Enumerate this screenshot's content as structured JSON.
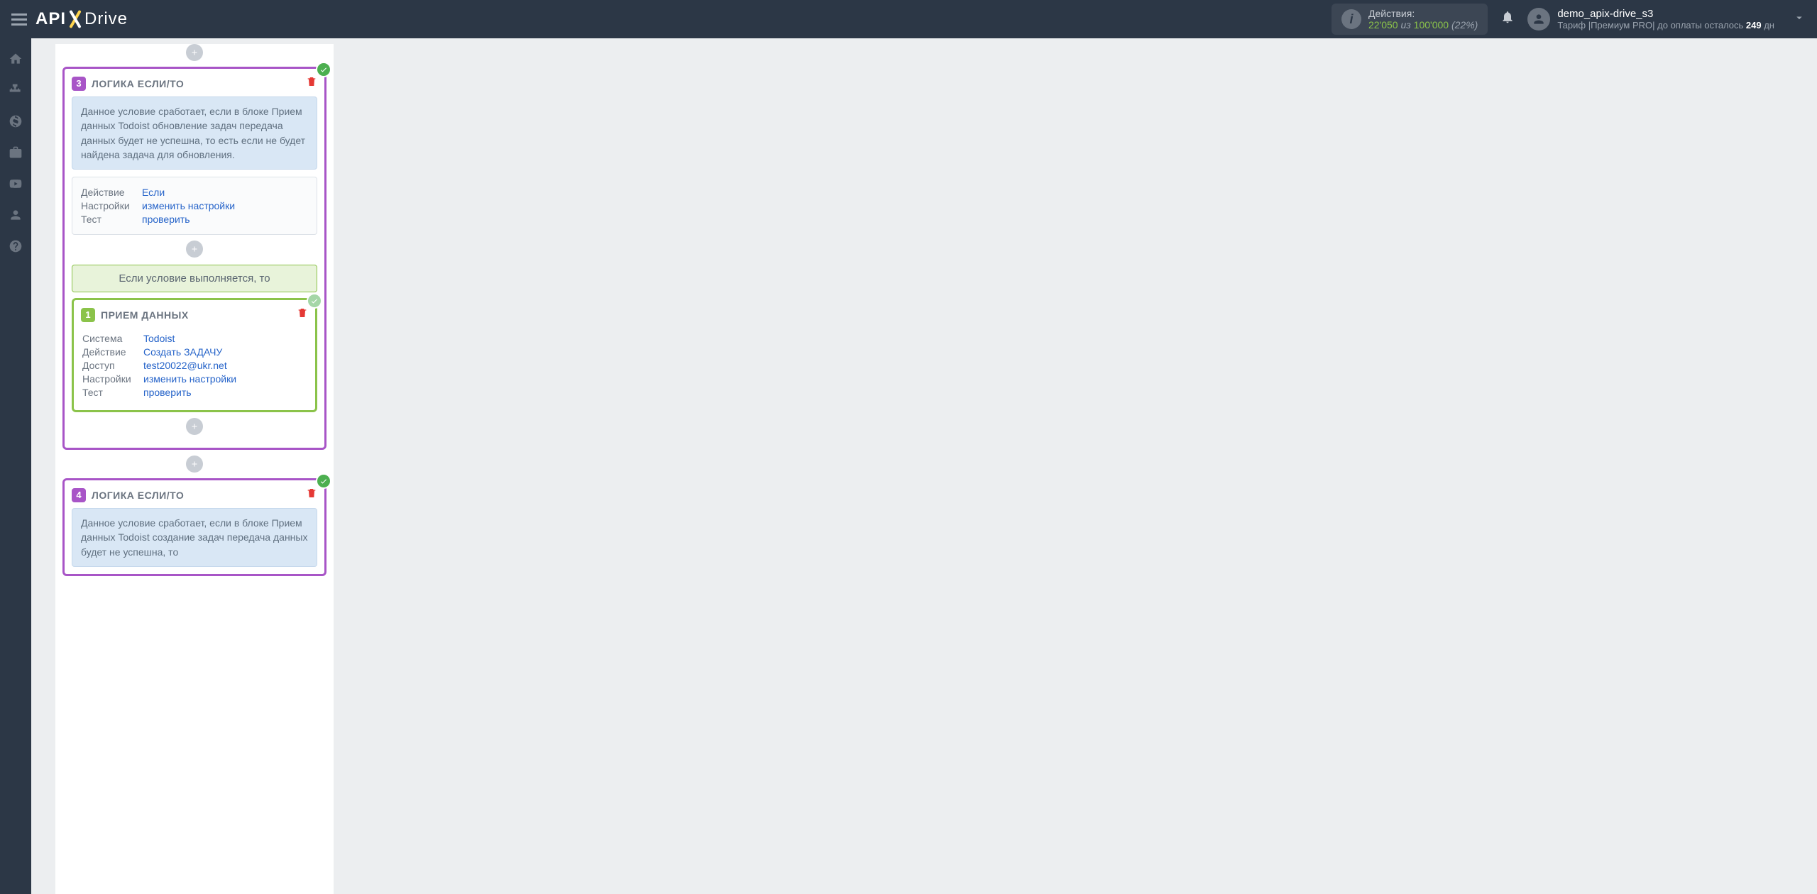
{
  "topbar": {
    "actions_label": "Действия:",
    "used": "22'050",
    "of": "из",
    "total": "100'000",
    "pct": "(22%)"
  },
  "user": {
    "name": "demo_apix-drive_s3",
    "tariff_prefix": "Тариф |Премиум PRO| до оплаты осталось ",
    "days": "249",
    "days_suffix": " дн"
  },
  "card3": {
    "num": "3",
    "title": "ЛОГИКА ЕСЛИ/ТО",
    "desc": "Данное условие сработает, если в блоке Прием данных Todoist обновление задач передача данных будет не успешна, то есть если не будет найдена задача для обновления.",
    "f1_label": "Действие",
    "f1_val": "Если",
    "f2_label": "Настройки",
    "f2_val": "изменить настройки",
    "f3_label": "Тест",
    "f3_val": "проверить",
    "cond": "Если условие выполняется, то"
  },
  "nested1": {
    "num": "1",
    "title": "ПРИЕМ ДАННЫХ",
    "f1_label": "Система",
    "f1_val": "Todoist",
    "f2_label": "Действие",
    "f2_val": "Создать ЗАДАЧУ",
    "f3_label": "Доступ",
    "f3_val": "test20022@ukr.net",
    "f4_label": "Настройки",
    "f4_val": "изменить настройки",
    "f5_label": "Тест",
    "f5_val": "проверить"
  },
  "card4": {
    "num": "4",
    "title": "ЛОГИКА ЕСЛИ/ТО",
    "desc": "Данное условие сработает, если в блоке Прием данных Todoist создание задач передача данных будет не успешна, то"
  }
}
